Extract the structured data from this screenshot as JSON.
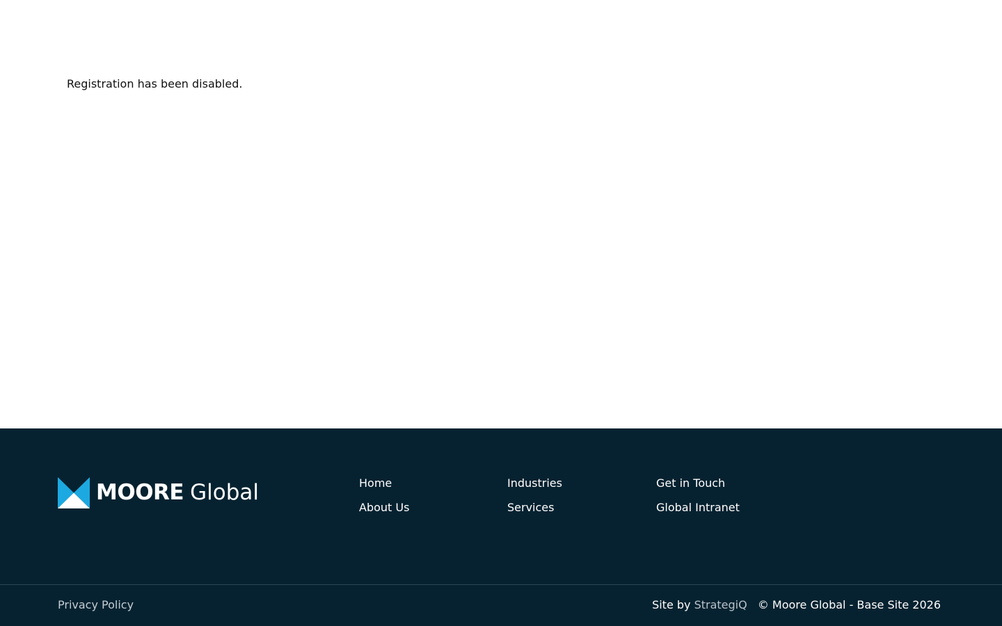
{
  "main": {
    "message": "Registration has been disabled."
  },
  "footer": {
    "logo": {
      "brand_strong": "MOORE",
      "brand_light": "Global",
      "icon": "moore-logo-mark-icon",
      "colors": {
        "mark_blue": "#1ca9e1",
        "mark_white": "#ffffff"
      }
    },
    "nav": {
      "home": "Home",
      "about": "About Us",
      "industries": "Industries",
      "services": "Services",
      "contact": "Get in Touch",
      "intranet": "Global Intranet"
    },
    "privacy": "Privacy Policy",
    "site_by_prefix": "Site by",
    "site_by_studio": "StrategiQ",
    "copyright": "© Moore Global - Base Site 2026",
    "colors": {
      "background": "#062230",
      "text": "#ffffff",
      "muted_text": "#c4cdd3"
    }
  }
}
